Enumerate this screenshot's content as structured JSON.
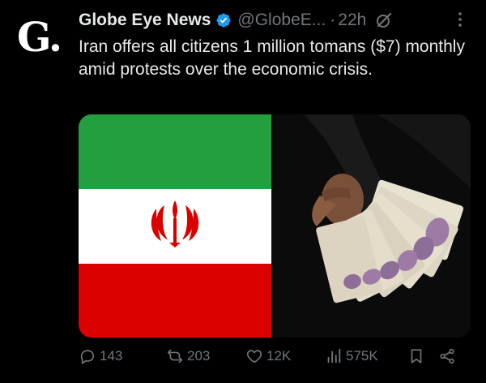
{
  "author": {
    "avatar_letter": "G.",
    "name": "Globe Eye News",
    "handle": "@GlobeE...",
    "time": "22h",
    "separator": "·"
  },
  "tweet": {
    "text": "Iran offers all citizens 1 million tomans ($7) monthly amid protests over the economic crisis."
  },
  "actions": {
    "replies": "143",
    "reposts": "203",
    "likes": "12K",
    "views": "575K"
  },
  "colors": {
    "background": "#000000",
    "text": "#e7e9ea",
    "muted": "#71767b",
    "verified": "#1d9bf0",
    "flag_green": "#239f40",
    "flag_white": "#ffffff",
    "flag_red": "#da0000"
  },
  "icons": [
    "verified-badge-icon",
    "grok-icon",
    "more-icon",
    "reply-icon",
    "repost-icon",
    "like-icon",
    "views-icon",
    "bookmark-icon",
    "share-icon"
  ]
}
